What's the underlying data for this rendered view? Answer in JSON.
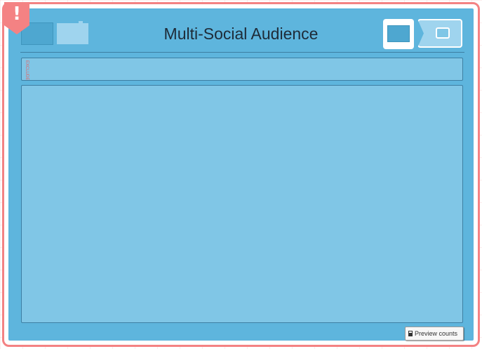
{
  "title": "Multi-Social Audience",
  "alert": {
    "glyph": "!"
  },
  "exclude": {
    "label": "EXCLUDE"
  },
  "preview": {
    "label": "Preview counts"
  },
  "icons": {
    "alert": "alert-icon",
    "folder_dark": "folder-icon",
    "folder_light": "folder-icon",
    "view_large": "monitor-icon",
    "view_small": "monitor-icon",
    "calculator": "calculator-icon"
  },
  "colors": {
    "accent": "#f48283",
    "panel": "#5eb5dd",
    "inner_panel": "#80c6e6",
    "border": "#3d7fa3"
  }
}
